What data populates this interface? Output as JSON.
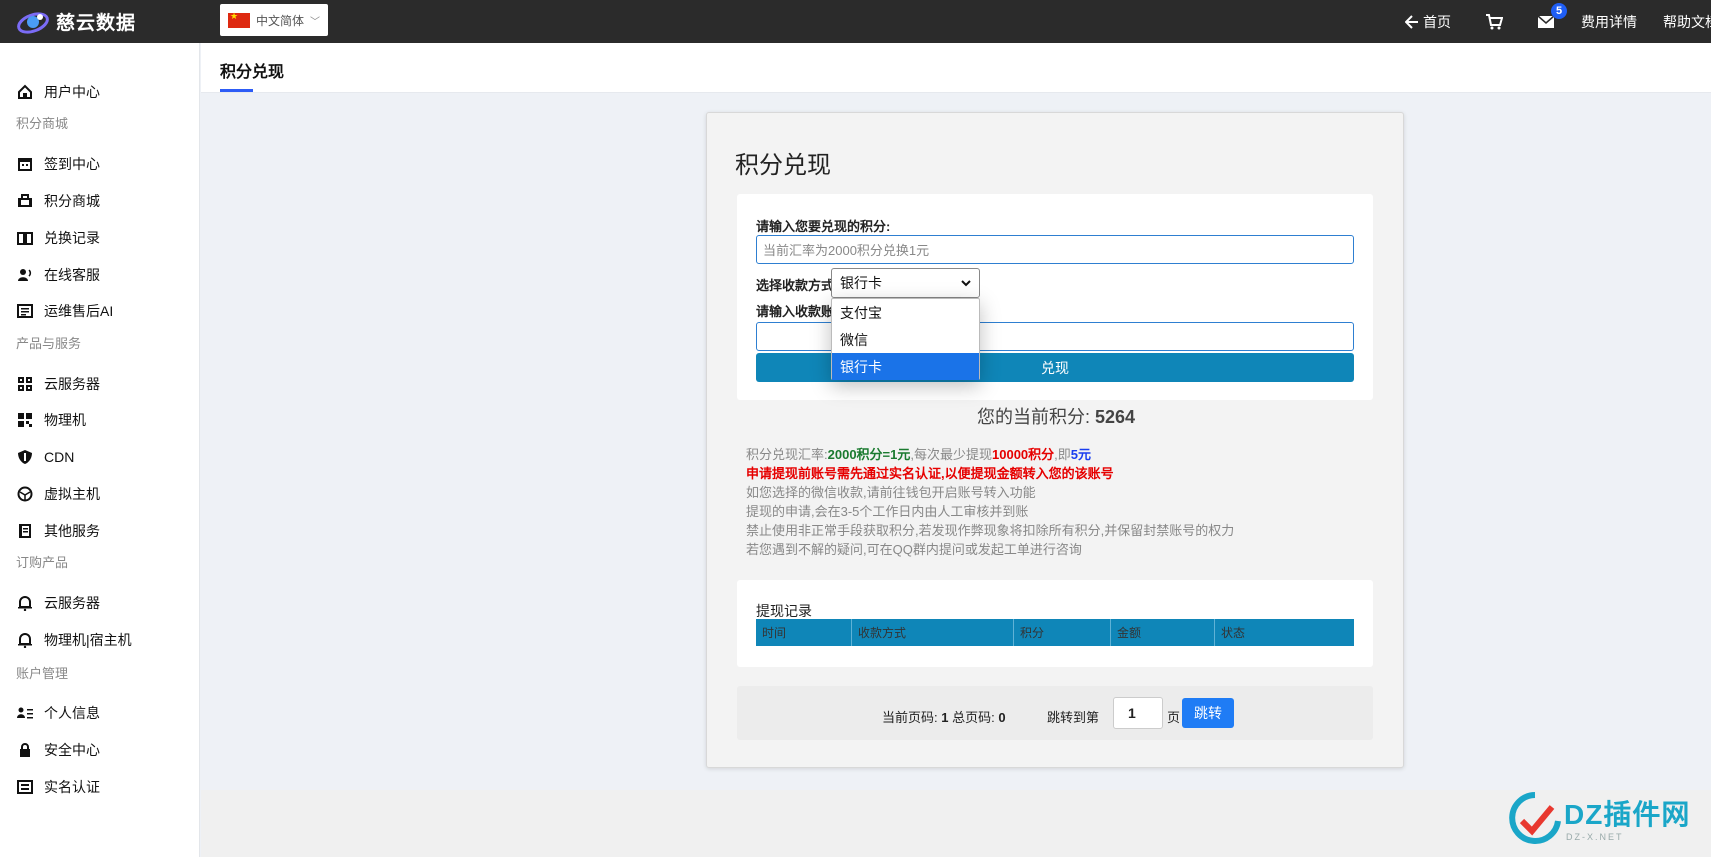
{
  "app": {
    "brand": "慈云数据"
  },
  "topbar": {
    "language": "中文简体",
    "nav": [
      {
        "label": "首页",
        "icon": "home-back-icon"
      },
      {
        "label": "",
        "icon": "cart-icon"
      },
      {
        "label": "",
        "icon": "mail-icon",
        "badge": "5"
      },
      {
        "label": "费用详情"
      },
      {
        "label": "帮助文档"
      }
    ]
  },
  "sidebar": {
    "items": [
      {
        "label": "用户中心",
        "icon": "home-icon"
      },
      {
        "group": "积分商城"
      },
      {
        "label": "签到中心",
        "icon": "calendar-icon"
      },
      {
        "label": "积分商城",
        "icon": "briefcase-icon"
      },
      {
        "label": "兑换记录",
        "icon": "book-icon"
      },
      {
        "label": "在线客服",
        "icon": "support-icon"
      },
      {
        "label": "运维售后AI",
        "icon": "list-icon"
      },
      {
        "group": "产品与服务"
      },
      {
        "label": "云服务器",
        "icon": "grid-icon"
      },
      {
        "label": "物理机",
        "icon": "qr-icon"
      },
      {
        "label": "CDN",
        "icon": "shield-icon"
      },
      {
        "label": "虚拟主机",
        "icon": "globe-icon"
      },
      {
        "label": "其他服务",
        "icon": "doc-icon"
      },
      {
        "group": "订购产品"
      },
      {
        "label": "云服务器",
        "icon": "bell-icon"
      },
      {
        "label": "物理机|宿主机",
        "icon": "bell-icon"
      },
      {
        "group": "账户管理"
      },
      {
        "label": "个人信息",
        "icon": "user-card-icon"
      },
      {
        "label": "安全中心",
        "icon": "lock-icon"
      },
      {
        "label": "实名认证",
        "icon": "id-icon"
      }
    ]
  },
  "page": {
    "title": "积分兑现"
  },
  "card": {
    "title": "积分兑现",
    "points_label": "请输入您要兑现的积分:",
    "points_placeholder": "当前汇率为2000积分兑换1元",
    "method_label": "选择收款方式:",
    "method_selected": "银行卡",
    "method_options": [
      "支付宝",
      "微信",
      "银行卡"
    ],
    "account_label": "请输入收款账号",
    "submit": "兑现",
    "current_points_label": "您的当前积分:",
    "current_points": "5264",
    "notes": {
      "rate_prefix": "积分兑现汇率:",
      "rate": "2000积分=1元",
      "min_prefix": ",每次最少提现",
      "min": "10000积分",
      "eq_prefix": ",即",
      "eq": "5元",
      "warning": "申请提现前账号需先通过实名认证,以便提现金额转入您的该账号",
      "line3": "如您选择的微信收款,请前往钱包开启账号转入功能",
      "line4": "提现的申请,会在3-5个工作日内由人工审核并到账",
      "line5": "禁止使用非正常手段获取积分,若发现作弊现象将扣除所有积分,并保留封禁账号的权力",
      "line6": "若您遇到不解的疑问,可在QQ群内提问或发起工单进行咨询"
    },
    "records": {
      "title": "提现记录",
      "columns": [
        "时间",
        "收款方式",
        "积分",
        "金额",
        "状态"
      ]
    },
    "pager": {
      "current_label": "当前页码:",
      "current": "1",
      "total_label": "总页码:",
      "total": "0",
      "jump_label": "跳转到第",
      "jump_value": "1",
      "page_unit": "页",
      "jump_button": "跳转"
    }
  },
  "watermark": {
    "text": "DZ插件网",
    "sub": "DZ-X.NET"
  }
}
